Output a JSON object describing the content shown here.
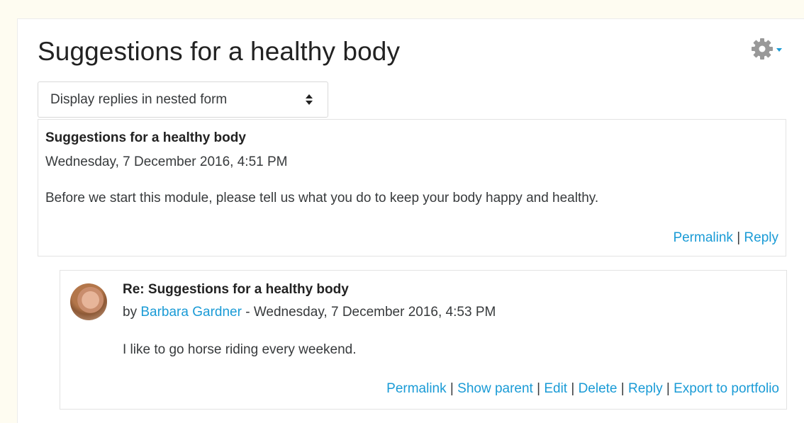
{
  "page": {
    "title": "Suggestions for a healthy body"
  },
  "settings": {
    "icon": "gear-icon",
    "accent": "#1a9bd6"
  },
  "display_mode": {
    "selected": "Display replies in nested form"
  },
  "posts": [
    {
      "subject": "Suggestions for a healthy body",
      "date": "Wednesday, 7 December 2016, 4:51 PM",
      "message": "Before we start this module, please tell us what you do to keep your body happy and healthy.",
      "commands": {
        "permalink": "Permalink",
        "reply": "Reply"
      }
    },
    {
      "subject": "Re: Suggestions for a healthy body",
      "by_prefix": "by ",
      "author": "Barbara Gardner",
      "date_sep": " - ",
      "date": "Wednesday, 7 December 2016, 4:53 PM",
      "message": "I like to go horse riding every weekend.",
      "commands": {
        "permalink": "Permalink",
        "show_parent": "Show parent",
        "edit": "Edit",
        "delete": "Delete",
        "reply": "Reply",
        "export": "Export to portfolio"
      },
      "separator": " | "
    }
  ]
}
